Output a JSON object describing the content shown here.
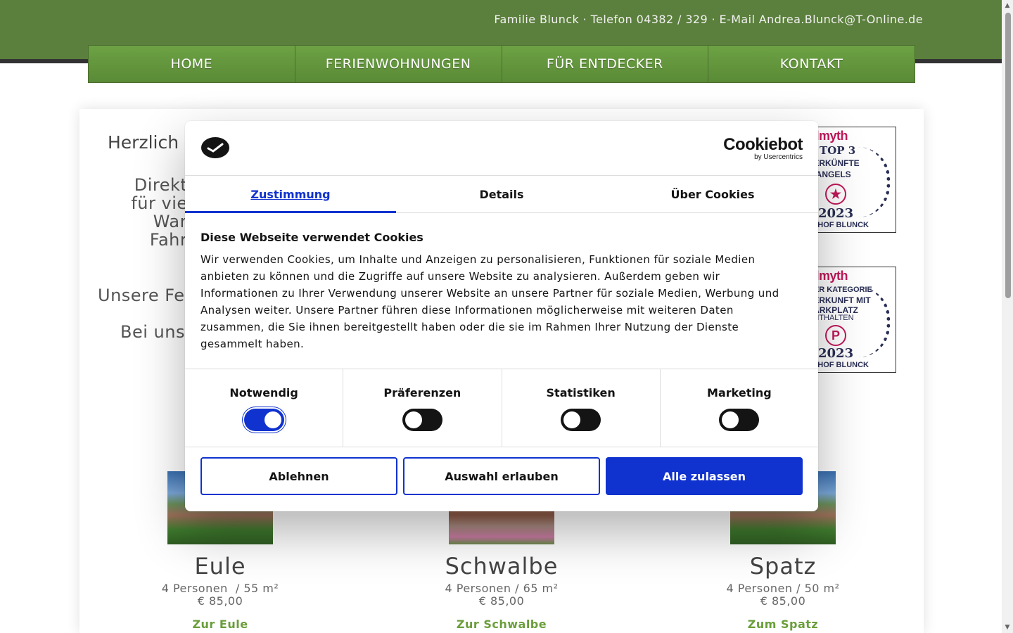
{
  "header": {
    "contact": "Familie Blunck · Telefon 04382 / 329 · E-Mail Andrea.Blunck@T-Online.de"
  },
  "nav": {
    "items": [
      "HOME",
      "FERIENWOHNUNGEN",
      "FÜR ENTDECKER",
      "KONTAKT"
    ]
  },
  "intro": {
    "welcome": "Herzlich W",
    "lines": [
      "Direkt an d",
      "für viele Me",
      "Wange",
      "Fahrrad"
    ],
    "unsere": "Unsere Fer",
    "bei_uns": "Bei uns"
  },
  "awards": [
    {
      "brand": "avelmyth",
      "line1": "TOP 3",
      "line2": "TERKÜNFTE",
      "line3": "WANGELS",
      "year": "2023",
      "bottom": "ENHOF BLUNCK"
    },
    {
      "brand": "avelmyth",
      "line1": "DER KATEGORIE",
      "line2": "TERKUNFT MIT",
      "line3": "PARKPLATZ",
      "line4": "ENTHALTEN",
      "icon": "P",
      "year": "2023",
      "bottom": "ENHOF BLUNCK"
    }
  ],
  "apartments": [
    {
      "name": "Eule",
      "size": "4 Personen  / 55 m²",
      "price": "€ 85,00",
      "link": "Zur Eule"
    },
    {
      "name": "Schwalbe",
      "size": "4 Personen / 65 m²",
      "price": "€ 85,00",
      "link": "Zur Schwalbe"
    },
    {
      "name": "Spatz",
      "size": "4 Personen / 50 m²",
      "price": "€ 85,00",
      "link": "Zum Spatz"
    }
  ],
  "cookie_dialog": {
    "brand": "Cookiebot",
    "brand_sub": "by Usercentrics",
    "tabs": [
      "Zustimmung",
      "Details",
      "Über Cookies"
    ],
    "active_tab": "Zustimmung",
    "title": "Diese Webseite verwendet Cookies",
    "body": "Wir verwenden Cookies, um Inhalte und Anzeigen zu personalisieren, Funktionen für soziale Medien anbieten zu können und die Zugriffe auf unsere Website zu analysieren. Außerdem geben wir Informationen zu Ihrer Verwendung unserer Website an unsere Partner für soziale Medien, Werbung und Analysen weiter. Unsere Partner führen diese Informationen möglicherweise mit weiteren Daten zusammen, die Sie ihnen bereitgestellt haben oder die sie im Rahmen Ihrer Nutzung der Dienste gesammelt haben.",
    "toggles": [
      {
        "label": "Notwendig",
        "on": true
      },
      {
        "label": "Präferenzen",
        "on": false
      },
      {
        "label": "Statistiken",
        "on": false
      },
      {
        "label": "Marketing",
        "on": false
      }
    ],
    "buttons": {
      "decline": "Ablehnen",
      "allow_selection": "Auswahl erlauben",
      "allow_all": "Alle zulassen"
    },
    "accent_color": "#1032cf"
  },
  "theme": {
    "header_green": "#5b7f3c",
    "link_green": "#6a9e3a"
  }
}
